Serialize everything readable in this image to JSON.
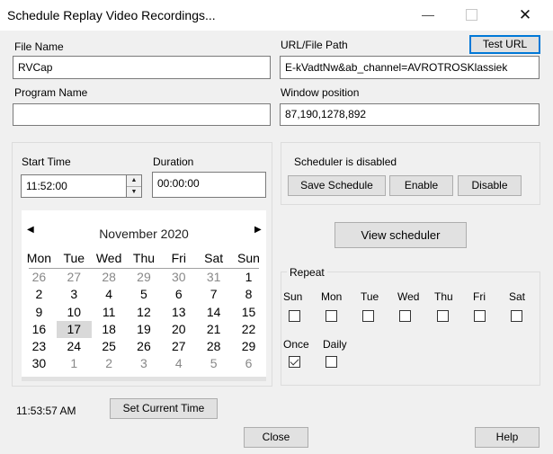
{
  "window": {
    "title": "Schedule Replay Video Recordings..."
  },
  "fields": {
    "file_name_label": "File Name",
    "file_name_value": "RVCap",
    "url_label": "URL/File Path",
    "url_value": "E-kVadtNw&ab_channel=AVROTROSKlassiek",
    "test_url_label": "Test URL",
    "program_name_label": "Program Name",
    "program_name_value": "",
    "window_position_label": "Window position",
    "window_position_value": "87,190,1278,892"
  },
  "time": {
    "start_time_label": "Start Time",
    "start_time_value": "11:52:00",
    "duration_label": "Duration",
    "duration_value": "00:00:00"
  },
  "calendar": {
    "month": "November 2020",
    "weekdays": [
      "Mon",
      "Tue",
      "Wed",
      "Thu",
      "Fri",
      "Sat",
      "Sun"
    ],
    "days": [
      {
        "d": "26",
        "other": true
      },
      {
        "d": "27",
        "other": true
      },
      {
        "d": "28",
        "other": true
      },
      {
        "d": "29",
        "other": true
      },
      {
        "d": "30",
        "other": true
      },
      {
        "d": "31",
        "other": true
      },
      {
        "d": "1"
      },
      {
        "d": "2"
      },
      {
        "d": "3"
      },
      {
        "d": "4"
      },
      {
        "d": "5"
      },
      {
        "d": "6"
      },
      {
        "d": "7"
      },
      {
        "d": "8"
      },
      {
        "d": "9"
      },
      {
        "d": "10"
      },
      {
        "d": "11"
      },
      {
        "d": "12"
      },
      {
        "d": "13"
      },
      {
        "d": "14"
      },
      {
        "d": "15"
      },
      {
        "d": "16"
      },
      {
        "d": "17",
        "today": true
      },
      {
        "d": "18"
      },
      {
        "d": "19"
      },
      {
        "d": "20"
      },
      {
        "d": "21"
      },
      {
        "d": "22"
      },
      {
        "d": "23"
      },
      {
        "d": "24"
      },
      {
        "d": "25"
      },
      {
        "d": "26"
      },
      {
        "d": "27"
      },
      {
        "d": "28"
      },
      {
        "d": "29"
      },
      {
        "d": "30"
      },
      {
        "d": "1",
        "other": true
      },
      {
        "d": "2",
        "other": true
      },
      {
        "d": "3",
        "other": true
      },
      {
        "d": "4",
        "other": true
      },
      {
        "d": "5",
        "other": true
      },
      {
        "d": "6",
        "other": true
      }
    ]
  },
  "scheduler": {
    "status": "Scheduler is disabled",
    "save_label": "Save Schedule",
    "enable_label": "Enable",
    "disable_label": "Disable",
    "view_label": "View scheduler"
  },
  "repeat": {
    "label": "Repeat",
    "days": [
      {
        "label": "Sun",
        "checked": false
      },
      {
        "label": "Mon",
        "checked": false
      },
      {
        "label": "Tue",
        "checked": false
      },
      {
        "label": "Wed",
        "checked": false
      },
      {
        "label": "Thu",
        "checked": false
      },
      {
        "label": "Fri",
        "checked": false
      },
      {
        "label": "Sat",
        "checked": false
      }
    ],
    "once_label": "Once",
    "once_checked": true,
    "daily_label": "Daily",
    "daily_checked": false
  },
  "footer": {
    "current_time": "11:53:57 AM",
    "set_current_label": "Set Current Time",
    "close_label": "Close",
    "help_label": "Help"
  }
}
